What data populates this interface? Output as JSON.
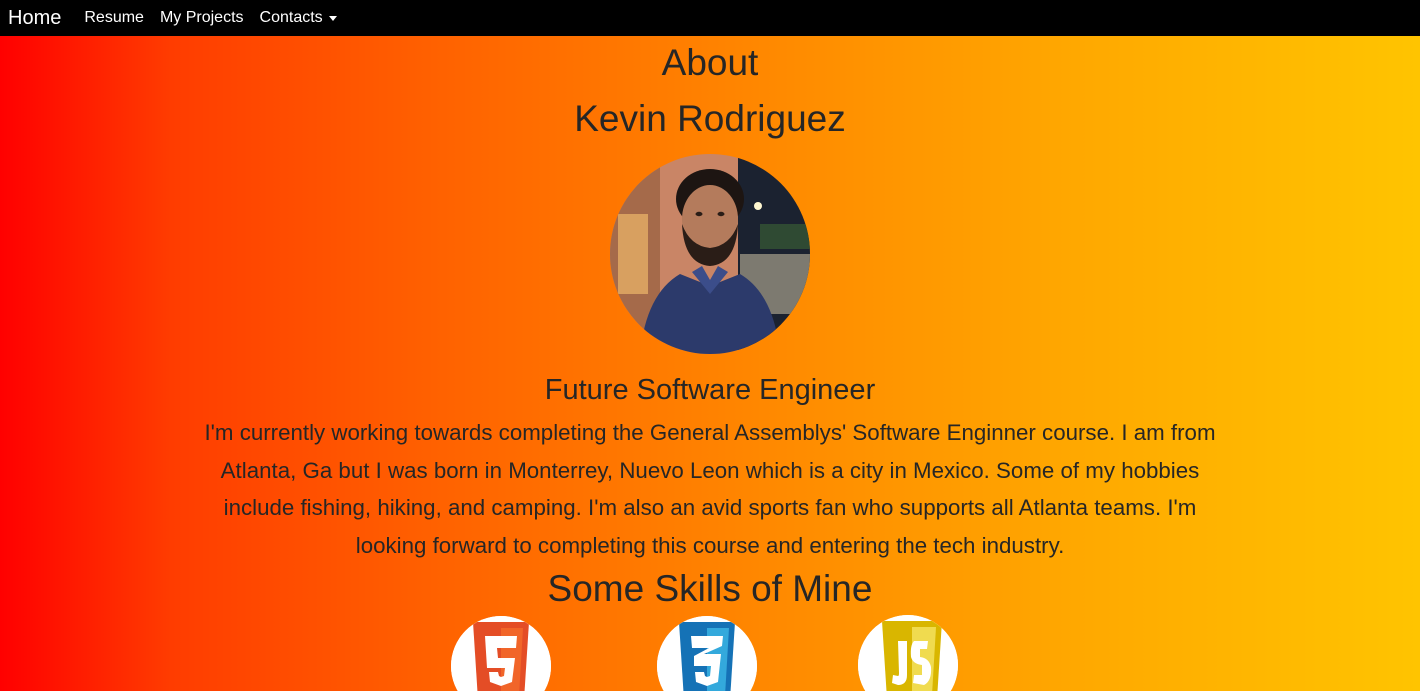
{
  "nav": {
    "brand": "Home",
    "links": [
      "Resume",
      "My Projects"
    ],
    "dropdown": "Contacts"
  },
  "about": {
    "heading": "About",
    "name": "Kevin Rodriguez",
    "role": "Future Software Engineer",
    "bio": "I'm currently working towards completing the General Assemblys' Software Enginner course. I am from Atlanta, Ga but I was born in Monterrey, Nuevo Leon which is a city in Mexico. Some of my hobbies include fishing, hiking, and camping. I'm also an avid sports fan who supports all Atlanta teams. I'm looking forward to completing this course and entering the tech industry."
  },
  "skills": {
    "heading": "Some Skills of Mine",
    "icons": [
      "html5-icon",
      "css3-icon",
      "javascript-icon"
    ],
    "colors": {
      "html5": "#e44d26",
      "css3": "#1572b6",
      "javascript": "#f0db4f"
    }
  },
  "gradient": {
    "start": "#ff0000",
    "end": "#ffc400"
  }
}
